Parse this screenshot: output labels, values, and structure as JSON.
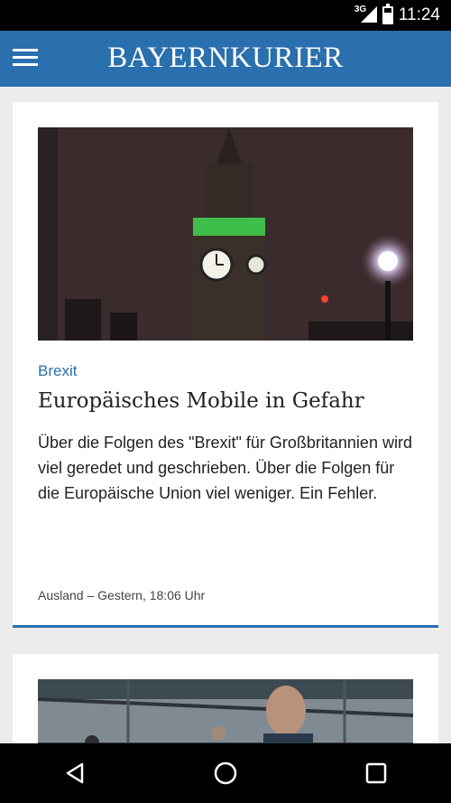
{
  "status_bar": {
    "network": "3G",
    "time": "11:24"
  },
  "app_bar": {
    "title": "BAYERNKURIER",
    "menu_icon": "hamburger-menu-icon",
    "color": "#2a6fae"
  },
  "articles": [
    {
      "category": "Brexit",
      "headline": "Europäisches Mobile in Gefahr",
      "teaser": "Über die Folgen des \"Brexit\" für Großbritannien wird viel geredet und geschrieben. Über die Folgen für die Europäische Union viel weniger. Ein Fehler.",
      "meta": "Ausland – Gestern, 18:06 Uhr"
    }
  ],
  "nav_bar": {
    "icons": [
      "back-icon",
      "home-icon",
      "recents-icon"
    ]
  }
}
